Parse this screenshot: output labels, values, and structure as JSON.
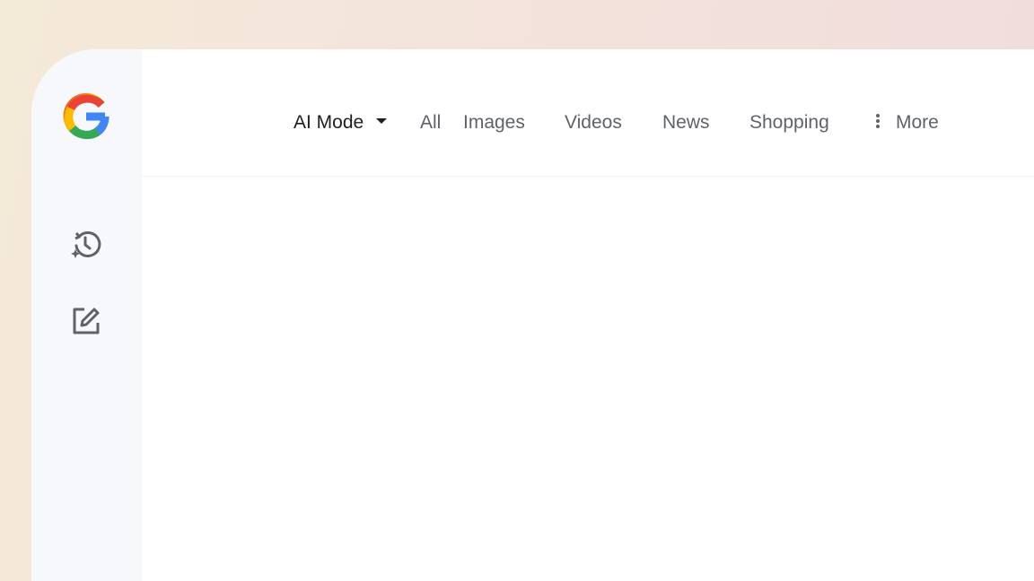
{
  "sidebar": {
    "logo_icon": "google-g-logo",
    "history_icon": "history-sparkle-icon",
    "new_chat_icon": "edit-square-icon"
  },
  "tabs": {
    "ai_mode": "AI Mode",
    "all": "All",
    "images": "Images",
    "videos": "Videos",
    "news": "News",
    "shopping": "Shopping",
    "more": "More"
  },
  "colors": {
    "google_blue": "#4285F4",
    "google_red": "#EA4335",
    "google_yellow": "#FBBC05",
    "google_green": "#34A853",
    "icon_gray": "#5f6368"
  }
}
